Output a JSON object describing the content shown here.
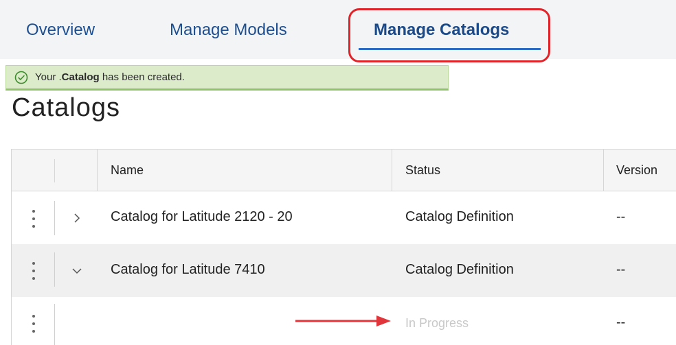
{
  "tabs": [
    {
      "label": "Overview"
    },
    {
      "label": "Manage Models"
    },
    {
      "label": "Manage Catalogs"
    }
  ],
  "toast": {
    "prefix": "Your .",
    "bold": "Catalog",
    "suffix": " has been created."
  },
  "page": {
    "title": "Catalogs"
  },
  "table": {
    "headers": {
      "name": "Name",
      "status": "Status",
      "version": "Version"
    },
    "rows": [
      {
        "name": "Catalog for Latitude 2120 - 20",
        "status": "Catalog Definition",
        "version": "--",
        "expanded": false
      },
      {
        "name": "Catalog for Latitude 7410",
        "status": "Catalog Definition",
        "version": "--",
        "expanded": true
      },
      {
        "name": "",
        "status": "In Progress",
        "version": "--"
      }
    ]
  },
  "colors": {
    "tab_text": "#1d4f91",
    "active_underline": "#2b6cc4",
    "highlight": "#e0242a",
    "toast_bg": "#dceccb",
    "success_icon": "#3c8c2c",
    "arrow": "#e0353a"
  },
  "icons": [
    "success-check-icon",
    "kebab-menu-icon",
    "chevron-right-icon",
    "chevron-down-icon",
    "annotation-arrow-icon"
  ]
}
